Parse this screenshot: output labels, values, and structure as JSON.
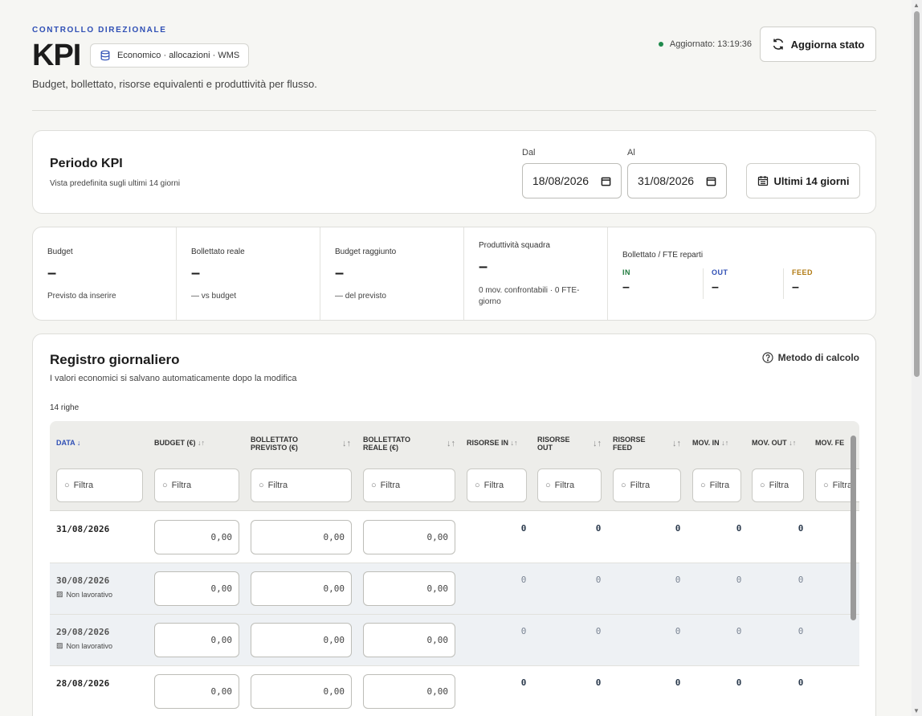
{
  "header": {
    "eyebrow": "CONTROLLO DIREZIONALE",
    "title": "KPI",
    "source_chip": "Economico · allocazioni · WMS",
    "subtitle": "Budget, bollettato, risorse equivalenti e produttività per flusso.",
    "updated_label": "Aggiornato: 13:19:36",
    "refresh_label": "Aggiorna stato"
  },
  "period": {
    "title": "Periodo KPI",
    "hint": "Vista predefinita sugli ultimi 14 giorni",
    "from_label": "Dal",
    "from_value": "18/08/2026",
    "to_label": "Al",
    "to_value": "31/08/2026",
    "preset_label": "Ultimi 14 giorni"
  },
  "stats": [
    {
      "label": "Budget",
      "value": "–",
      "note": "Previsto da inserire"
    },
    {
      "label": "Bollettato reale",
      "value": "–",
      "note": "— vs budget"
    },
    {
      "label": "Budget raggiunto",
      "value": "–",
      "note": "— del previsto"
    },
    {
      "label": "Produttività squadra",
      "value": "–",
      "note": "0 mov. confrontabili · 0 FTE-giorno"
    }
  ],
  "fte": {
    "label": "Bollettato / FTE reparti",
    "in_label": "IN",
    "in_value": "–",
    "in_color": "#1f7a3d",
    "out_label": "OUT",
    "out_value": "–",
    "out_color": "#2f4fb5",
    "feed_label": "FEED",
    "feed_value": "–",
    "feed_color": "#b07a12"
  },
  "registry": {
    "title": "Registro giornaliero",
    "hint": "I valori economici si salvano automaticamente dopo la modifica",
    "row_count": "14 righe",
    "method_label": "Metodo di calcolo",
    "filter_placeholder": "Filtra",
    "columns": [
      {
        "label": "DATA",
        "sort": "↓"
      },
      {
        "label": "BUDGET (€)",
        "sort": "↓↑"
      },
      {
        "label": "BOLLETTATO PREVISTO (€)",
        "sort": "↓↑"
      },
      {
        "label": "BOLLETTATO REALE (€)",
        "sort": "↓↑"
      },
      {
        "label": "RISORSE IN",
        "sort": "↓↑"
      },
      {
        "label": "RISORSE OUT",
        "sort": "↓↑"
      },
      {
        "label": "RISORSE FEED",
        "sort": "↓↑"
      },
      {
        "label": "MOV. IN",
        "sort": "↓↑"
      },
      {
        "label": "MOV. OUT",
        "sort": "↓↑"
      },
      {
        "label": "MOV. FE",
        "sort": ""
      }
    ],
    "nonwork_label": "Non lavorativo",
    "rows": [
      {
        "date": "31/08/2026",
        "nonwork": false,
        "budget": "0,00",
        "previsto": "0,00",
        "reale": "0,00",
        "r_in": "0",
        "r_out": "0",
        "r_feed": "0",
        "m_in": "0",
        "m_out": "0"
      },
      {
        "date": "30/08/2026",
        "nonwork": true,
        "budget": "0,00",
        "previsto": "0,00",
        "reale": "0,00",
        "r_in": "0",
        "r_out": "0",
        "r_feed": "0",
        "m_in": "0",
        "m_out": "0"
      },
      {
        "date": "29/08/2026",
        "nonwork": true,
        "budget": "0,00",
        "previsto": "0,00",
        "reale": "0,00",
        "r_in": "0",
        "r_out": "0",
        "r_feed": "0",
        "m_in": "0",
        "m_out": "0"
      },
      {
        "date": "28/08/2026",
        "nonwork": false,
        "budget": "0,00",
        "previsto": "0,00",
        "reale": "0,00",
        "r_in": "0",
        "r_out": "0",
        "r_feed": "0",
        "m_in": "0",
        "m_out": "0"
      }
    ]
  }
}
